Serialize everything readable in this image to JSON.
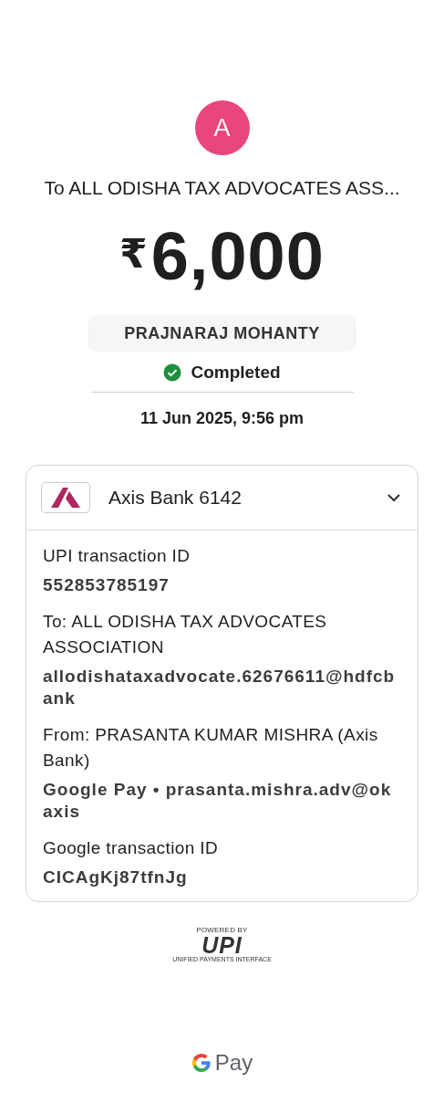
{
  "avatar": {
    "initial": "A",
    "color": "#e8467c"
  },
  "recipient_title": "To ALL ODISHA TAX ADVOCATES ASS...",
  "amount": {
    "currency": "₹",
    "value": "6,000"
  },
  "note": "PRAJNARAJ MOHANTY",
  "status": {
    "label": "Completed",
    "completed": true
  },
  "datetime": "11 Jun 2025, 9:56 pm",
  "card": {
    "bank": "Axis Bank 6142",
    "expanded": true,
    "details": [
      {
        "label": "UPI transaction ID",
        "value": "552853785197"
      },
      {
        "label": "To: ALL ODISHA TAX ADVOCATES ASSOCIATION",
        "value": "allodishataxadvocate.62676611@hdfcbank"
      },
      {
        "label": "From: PRASANTA KUMAR MISHRA (Axis Bank)",
        "value": "Google Pay • prasanta.mishra.adv@okaxis"
      },
      {
        "label": "Google transaction ID",
        "value": "CICAgKj87tfnJg"
      }
    ]
  },
  "upi_badge": {
    "powered_by": "POWERED BY",
    "logo": "UPI",
    "tagline": "UNIFIED PAYMENTS INTERFACE"
  },
  "footer_brand": "Pay"
}
